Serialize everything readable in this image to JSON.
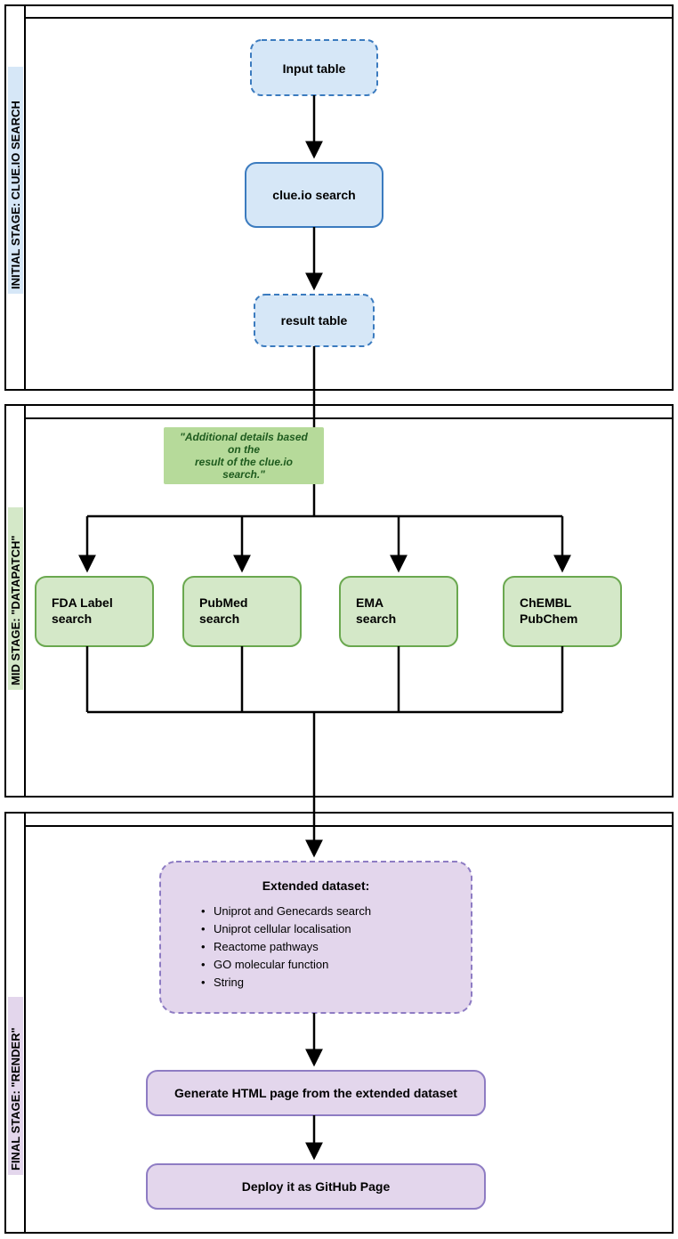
{
  "stages": {
    "initial": {
      "label": "INITIAL STAGE: CLUE.IO SEARCH"
    },
    "mid": {
      "label": "MID STAGE: \"DATAPATCH\""
    },
    "final": {
      "label": "FINAL STAGE: \"RENDER\""
    }
  },
  "nodes": {
    "input_table": {
      "label": "Input table"
    },
    "clue_search": {
      "label": "clue.io search"
    },
    "result_table": {
      "label": "result table"
    },
    "fda": {
      "line1": "FDA Label",
      "line2": "search"
    },
    "pubmed": {
      "line1": "PubMed",
      "line2": "search"
    },
    "ema": {
      "line1": "EMA",
      "line2": "search"
    },
    "chembl": {
      "line1": "ChEMBL",
      "line2": "PubChem"
    },
    "extended": {
      "heading": "Extended dataset:",
      "items": [
        "Uniprot and Genecards search",
        "Uniprot cellular localisation",
        "Reactome pathways",
        "GO molecular function",
        "String"
      ]
    },
    "generate": {
      "label": "Generate HTML page from the extended dataset"
    },
    "deploy": {
      "label": "Deploy it as GitHub Page"
    }
  },
  "note": {
    "line1": "\"Additional details based",
    "line2": "on the",
    "line3": "result of the clue.io",
    "line4": "search.\""
  }
}
